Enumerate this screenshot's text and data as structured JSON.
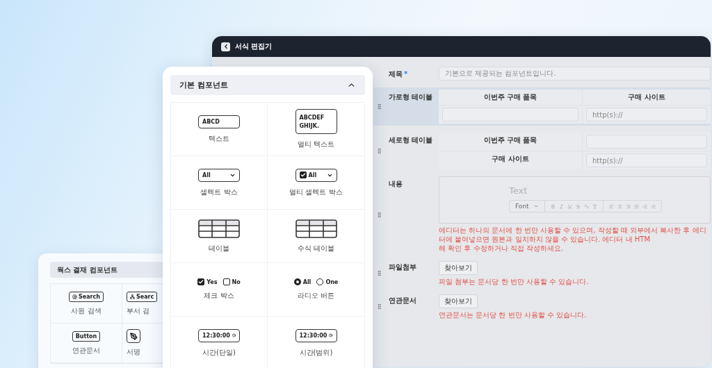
{
  "editor": {
    "title": "서식 편집기",
    "fields": [
      {
        "kind": "text",
        "label": "제목",
        "required": true,
        "required_mark": "*",
        "draggable": false,
        "selected": false,
        "placeholder": "기본으로 제공되는 컴포넌트입니다."
      },
      {
        "kind": "htable",
        "label": "가로형 테이블",
        "required": false,
        "draggable": true,
        "selected": true,
        "columns": [
          "이번주 구매 품목",
          "구매 사이트"
        ],
        "inputs": [
          {
            "kind": "empty"
          },
          {
            "kind": "hint",
            "placeholder": "http(s)://"
          }
        ]
      },
      {
        "kind": "vtable",
        "label": "세로형 테이블",
        "required": false,
        "draggable": true,
        "selected": false,
        "rows": [
          {
            "header": "이번주 구매 품목"
          },
          {
            "header": "구매 사이트",
            "placeholder": "http(s)://"
          }
        ]
      },
      {
        "kind": "editor",
        "label": "내용",
        "required": false,
        "draggable": true,
        "selected": false,
        "body_placeholder": "Text",
        "font_label": "Font",
        "notes": [
          "에디터는 하나의 문서에 한 번만 사용할 수 있으며, 작성할 때 외부에서 복사한 후 에디터에 붙여넣으면 원본과 일치하지 않을 수 있습니다. 에디터 내 HTM",
          "해 확인 후 수정하거나 직접 작성하세요."
        ]
      },
      {
        "kind": "file",
        "label": "파일첨부",
        "required": false,
        "draggable": true,
        "selected": false,
        "button": "찾아보기",
        "notes": [
          "파일 첨부는 문서당 한 번만 사용할 수 있습니다."
        ]
      },
      {
        "kind": "file",
        "label": "연관문서",
        "required": false,
        "draggable": true,
        "selected": false,
        "button": "찾아보기",
        "notes": [
          "연관문서는 문서당 한 번만 사용할 수 있습니다."
        ]
      }
    ]
  },
  "basic_panel": {
    "title": "기본 컴포넌트",
    "expanded": true,
    "items": [
      {
        "kind": "text",
        "label": "텍스트",
        "preview": [
          "ABCD"
        ]
      },
      {
        "kind": "multitext",
        "label": "멀티 텍스트",
        "preview": [
          "ABCDEF",
          "GHIJK."
        ]
      },
      {
        "kind": "select",
        "label": "셀렉트 박스",
        "preview": [
          "All"
        ]
      },
      {
        "kind": "multiselect",
        "label": "멀티 셀렉트 박스",
        "preview": [
          "All"
        ],
        "checked": true
      },
      {
        "kind": "table",
        "label": "테이블"
      },
      {
        "kind": "table",
        "label": "수식 테이블"
      },
      {
        "kind": "checkbox",
        "label": "체크 박스",
        "options": [
          {
            "label": "Yes",
            "checked": true
          },
          {
            "label": "No",
            "checked": false
          }
        ]
      },
      {
        "kind": "radio",
        "label": "라디오 버튼",
        "options": [
          {
            "label": "All",
            "selected": true
          },
          {
            "label": "One",
            "selected": false
          }
        ]
      },
      {
        "kind": "time",
        "label": "시간(단일)",
        "preview": [
          "12:30:00"
        ]
      },
      {
        "kind": "time",
        "label": "시간(범위)",
        "preview": [
          "12:30:00"
        ]
      }
    ]
  },
  "works_panel": {
    "title": "웍스 결재 컴포넌트",
    "items": [
      {
        "kind": "person-search",
        "label": "사원 검색",
        "preview": "Search"
      },
      {
        "kind": "org-search",
        "label": "부서 검",
        "preview": "Searc"
      },
      {
        "kind": "button",
        "label": "연관문서",
        "preview": "Button"
      },
      {
        "kind": "signature",
        "label": "서명"
      }
    ]
  }
}
